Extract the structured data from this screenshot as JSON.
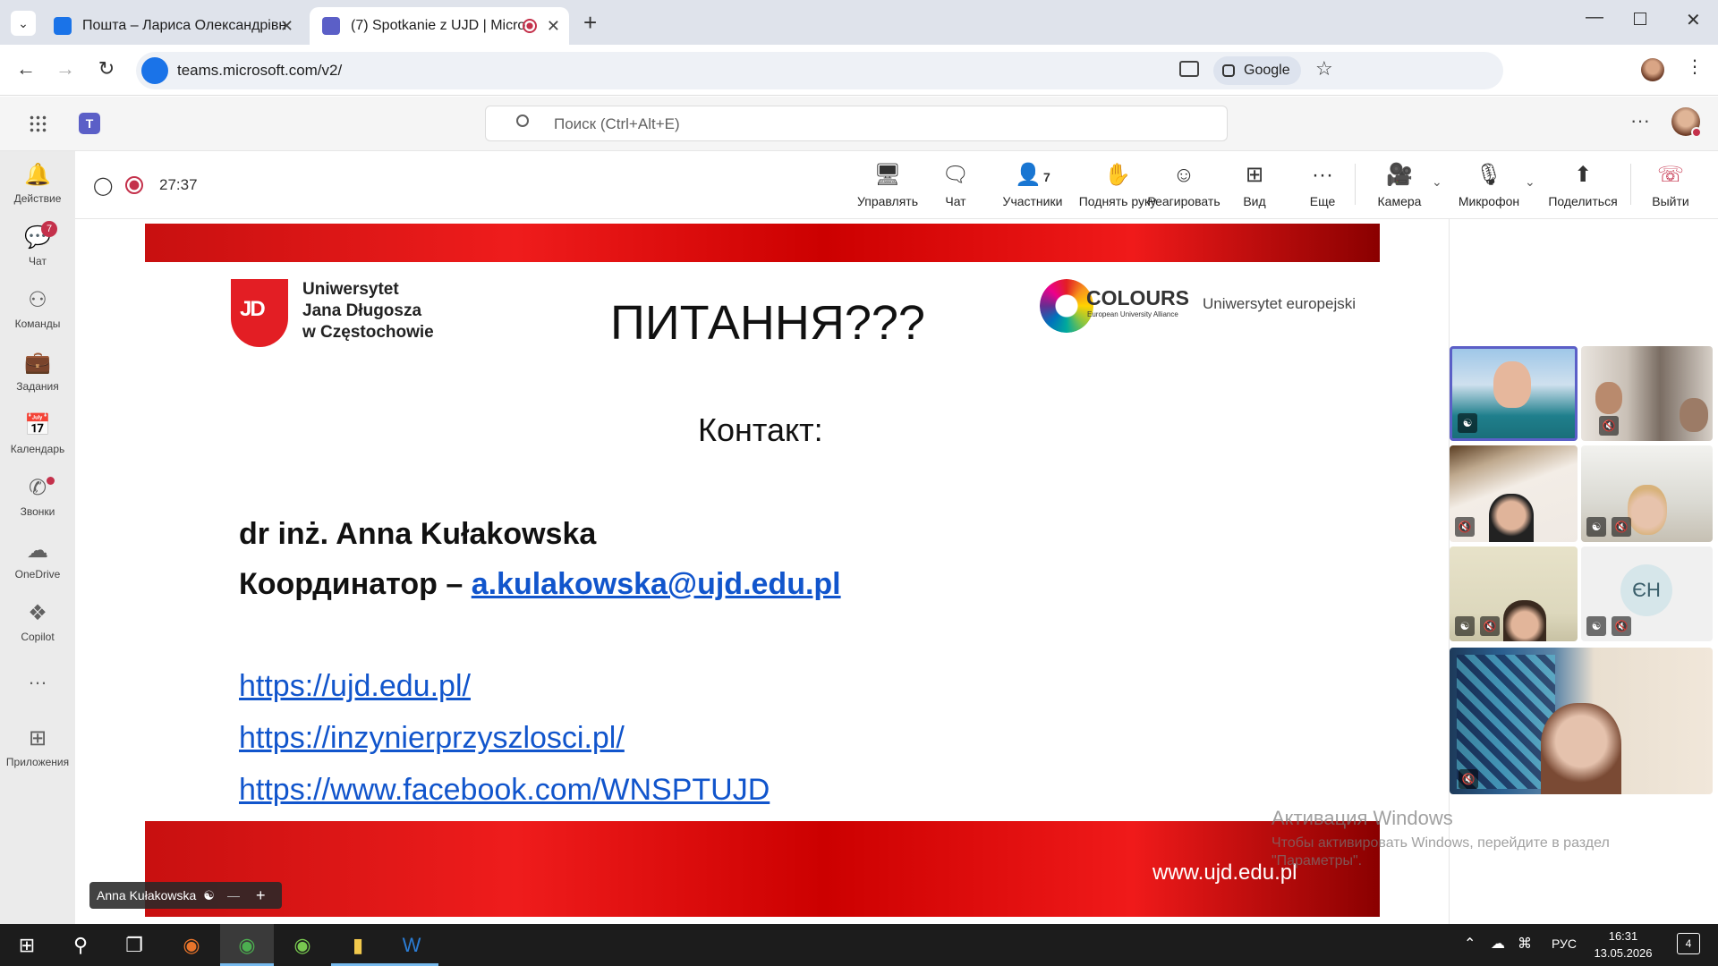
{
  "browser": {
    "tabs": [
      {
        "title": "Пошта – Лариса Олександрівн",
        "active": false
      },
      {
        "title": "(7) Spotkanie z UJD | Micro",
        "active": true
      }
    ],
    "url": "teams.microsoft.com/v2/",
    "google_label": "Google"
  },
  "teams": {
    "search_placeholder": "Поиск (Ctrl+Alt+E)",
    "rail": [
      {
        "label": "Действие",
        "icon": "bell-icon"
      },
      {
        "label": "Чат",
        "icon": "chat-icon",
        "badge": "7"
      },
      {
        "label": "Команды",
        "icon": "teams-icon"
      },
      {
        "label": "Задания",
        "icon": "assignments-icon"
      },
      {
        "label": "Календарь",
        "icon": "calendar-icon"
      },
      {
        "label": "Звонки",
        "icon": "phone-icon"
      },
      {
        "label": "OneDrive",
        "icon": "cloud-icon"
      },
      {
        "label": "Copilot",
        "icon": "copilot-icon"
      },
      {
        "label": "…",
        "icon": "more-icon"
      },
      {
        "label": "Приложения",
        "icon": "plus-icon"
      }
    ]
  },
  "meeting": {
    "timer": "27:37",
    "toolbar": [
      {
        "label": "Управлять",
        "icon": "share-screen-icon"
      },
      {
        "label": "Чат",
        "icon": "chat-icon"
      },
      {
        "label": "Участники",
        "icon": "people-icon",
        "count": "7"
      },
      {
        "label": "Поднять руку",
        "icon": "hand-icon"
      },
      {
        "label": "Реагировать",
        "icon": "smile-icon"
      },
      {
        "label": "Вид",
        "icon": "grid-icon"
      },
      {
        "label": "Еще",
        "icon": "more-icon"
      },
      {
        "label": "Камера",
        "icon": "camera-icon"
      },
      {
        "label": "Микрофон",
        "icon": "mic-off-icon"
      },
      {
        "label": "Поделиться",
        "icon": "share-icon"
      },
      {
        "label": "Выйти",
        "icon": "hangup-icon"
      }
    ],
    "presenter_name": "Anna Kułakowska"
  },
  "slide": {
    "university": [
      "Uniwersytet",
      "Jana Długosza",
      "w Częstochowie"
    ],
    "colours_title": "COLOURS",
    "colours_sub": "European University Alliance",
    "colours_right": "Uniwersytet europejski",
    "heading": "ПИТАННЯ???",
    "contact": "Контакт:",
    "name": "dr inż. Anna Kułakowska",
    "coord_label": "Координатор – ",
    "email": "a.kulakowska@ujd.edu.pl",
    "links": [
      "https://ujd.edu.pl/",
      "https://inzynierprzyszlosci.pl/",
      "https://www.facebook.com/WNSPTUJD"
    ],
    "footer_url": "www.ujd.edu.pl"
  },
  "participants": {
    "initials_tile": "ЄН"
  },
  "watermark": {
    "title": "Активация Windows",
    "line1": "Чтобы активировать Windows, перейдите в раздел",
    "line2": "\"Параметры\"."
  },
  "taskbar": {
    "lang": "РУС",
    "time": "16:31",
    "date": "13.05.2026",
    "notif_count": "4"
  },
  "colors": {
    "accent": "#5b5fc7",
    "hangup": "#c4314b",
    "slide_red": "#e31e24",
    "link": "#1155cc"
  }
}
